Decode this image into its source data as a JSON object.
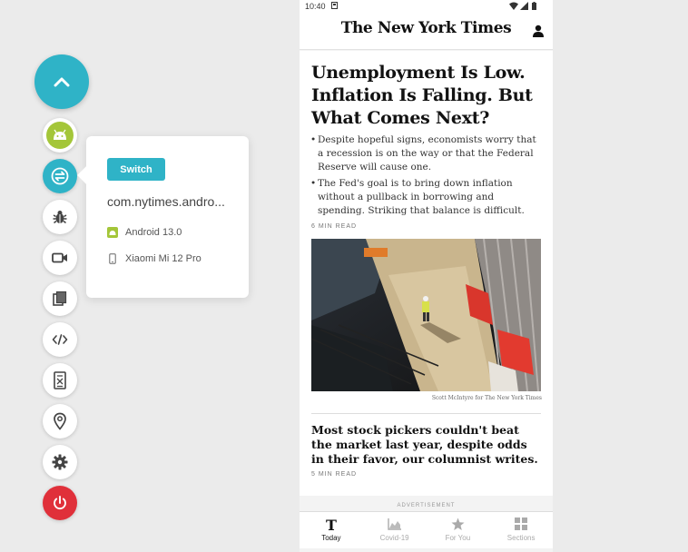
{
  "toolbar": {
    "items": [
      {
        "name": "android-device-icon"
      },
      {
        "name": "switch-app-icon"
      },
      {
        "name": "bug-icon"
      },
      {
        "name": "video-camera-icon"
      },
      {
        "name": "copy-icon"
      },
      {
        "name": "code-icon"
      },
      {
        "name": "device-logs-icon"
      },
      {
        "name": "location-pin-icon"
      },
      {
        "name": "gear-icon"
      },
      {
        "name": "power-icon"
      }
    ],
    "colors": {
      "accent": "#2fb3c7",
      "danger": "#e0303a",
      "android": "#a4c639"
    }
  },
  "popover": {
    "switch_label": "Switch",
    "package": "com.nytimes.andro...",
    "os": "Android  13.0",
    "device": "Xiaomi Mi 12 Pro"
  },
  "phone": {
    "status_time": "10:40",
    "masthead": "The New York Times",
    "article": {
      "headline": "Unemployment Is Low. Inflation Is Falling. But What Comes Next?",
      "bullets": [
        "Despite hopeful signs, economists worry that a recession is on the way or that the Federal Reserve will cause one.",
        "The Fed's goal is to bring down inflation without a pullback in borrowing and spending. Striking that balance is difficult."
      ],
      "read_time": "6 MIN READ",
      "photo_credit": "Scott McIntyre for The New York Times"
    },
    "article2": {
      "headline": "Most stock pickers couldn't beat the market last year, despite odds in their favor, our columnist writes.",
      "read_time": "5 MIN READ"
    },
    "ad_label": "ADVERTISEMENT",
    "nav": [
      {
        "label": "Today",
        "icon": "nyt-logo-icon"
      },
      {
        "label": "Covid-19",
        "icon": "chart-icon"
      },
      {
        "label": "For You",
        "icon": "star-icon"
      },
      {
        "label": "Sections",
        "icon": "grid-icon"
      }
    ]
  }
}
